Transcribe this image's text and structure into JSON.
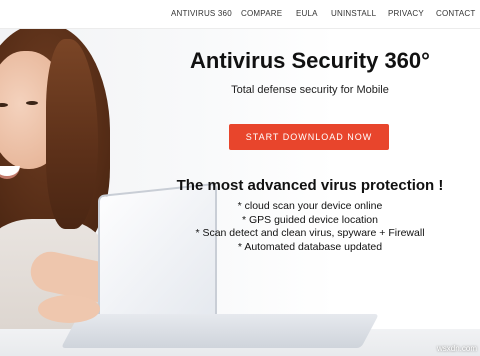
{
  "nav": {
    "items": [
      "ANTIVIRUS 360",
      "COMPARE",
      "EULA",
      "UNINSTALL",
      "PRIVACY",
      "CONTACT"
    ]
  },
  "hero": {
    "title": "Antivirus Security 360°",
    "subtitle": "Total defense security for Mobile",
    "cta_label": "START DOWNLOAD NOW",
    "headline": "The most advanced virus protection !",
    "features": [
      "* cloud scan your device online",
      "* GPS guided device location",
      "* Scan detect and clean virus, spyware + Firewall",
      "* Automated database updated"
    ]
  },
  "watermark": "wsxdn.com",
  "colors": {
    "accent": "#e8452c",
    "text": "#111111",
    "nav_text": "#333333"
  }
}
